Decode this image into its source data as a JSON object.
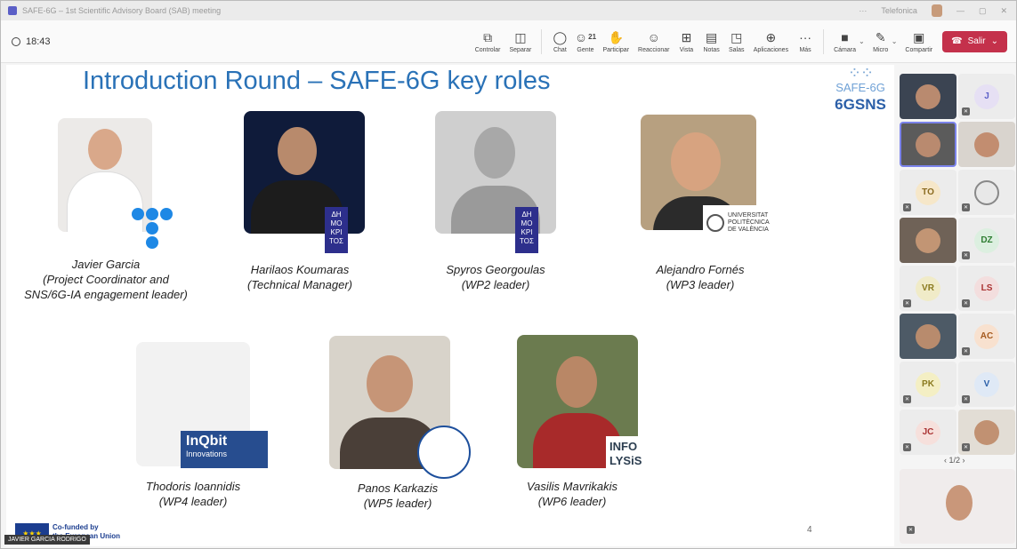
{
  "window": {
    "title": "SAFE-6G – 1st Scientific Advisory Board (SAB) meeting",
    "right_label": "Telefonica"
  },
  "toolbar": {
    "time": "18:43",
    "buttons": [
      {
        "label": "Controlar",
        "icon": "share-control-icon"
      },
      {
        "label": "Separar",
        "icon": "popout-icon"
      },
      {
        "label": "Chat",
        "icon": "chat-icon"
      },
      {
        "label": "Gente",
        "icon": "people-icon",
        "count": "21"
      },
      {
        "label": "Participar",
        "icon": "raise-hand-icon"
      },
      {
        "label": "Reaccionar",
        "icon": "smiley-icon"
      },
      {
        "label": "Vista",
        "icon": "grid-view-icon"
      },
      {
        "label": "Notas",
        "icon": "notes-icon"
      },
      {
        "label": "Salas",
        "icon": "rooms-icon"
      },
      {
        "label": "Aplicaciones",
        "icon": "apps-plus-icon"
      },
      {
        "label": "Más",
        "icon": "more-icon"
      }
    ],
    "media": [
      {
        "label": "Cámara",
        "icon": "camera-off-icon"
      },
      {
        "label": "Micro",
        "icon": "mic-off-icon"
      },
      {
        "label": "Compartir",
        "icon": "share-screen-icon"
      }
    ],
    "leave_label": "Salir",
    "accent_red": "#c4314b"
  },
  "slide": {
    "title": "Introduction Round – SAFE-6G key roles",
    "logo_safe": "SAFE-6G",
    "logo_sns": "6GSNS",
    "page_number": "4",
    "people": [
      {
        "name": "Javier Garcia",
        "role_line1": "(Project Coordinator and",
        "role_line2": "SNS/6G-IA engagement leader)"
      },
      {
        "name": "Harilaos Koumaras",
        "role_line1": "(Technical Manager)"
      },
      {
        "name": "Spyros Georgoulas",
        "role_line1": "(WP2 leader)"
      },
      {
        "name": "Alejandro Fornés",
        "role_line1": "(WP3 leader)"
      },
      {
        "name": "Thodoris Ioannidis",
        "role_line1": "(WP4 leader)"
      },
      {
        "name": "Panos Karkazis",
        "role_line1": "(WP5 leader)"
      },
      {
        "name": "Vasilis Mavrikakis",
        "role_line1": "(WP6 leader)"
      }
    ],
    "badges": {
      "upv_line1": "UNIVERSITAT",
      "upv_line2": "POLITÈCNICA",
      "upv_line3": "DE VALÈNCIA",
      "inqbit": "InQbit",
      "inqbit_sub": "Innovations",
      "infolysis_line1": "INFO",
      "infolysis_line2": "LYSiS",
      "demokritos": "ΔΗ ΜΟ ΚΡΙ ΤΟΣ"
    },
    "eu_line1": "Co-funded by",
    "eu_line2": "the European Union",
    "speaker": "JAVIER GARCIA RODRIGO"
  },
  "participants": {
    "tiles": [
      {
        "initials": "",
        "video": true
      },
      {
        "initials": "J",
        "video": false,
        "color": "#e6e0f4"
      },
      {
        "initials": "",
        "video": true,
        "active": true
      },
      {
        "initials": "",
        "video": true
      },
      {
        "initials": "TO",
        "video": false,
        "color": "#f6e7c9"
      },
      {
        "initials": "",
        "video": false,
        "color": "#e8e8e8",
        "generic": true
      },
      {
        "initials": "",
        "video": true
      },
      {
        "initials": "DZ",
        "video": false,
        "color": "#dcefe0"
      },
      {
        "initials": "VR",
        "video": false,
        "color": "#f0ebc8"
      },
      {
        "initials": "LS",
        "video": false,
        "color": "#f3dede"
      },
      {
        "initials": "",
        "video": true
      },
      {
        "initials": "AC",
        "video": false,
        "color": "#f8e1cf"
      },
      {
        "initials": "PK",
        "video": false,
        "color": "#f4efc4"
      },
      {
        "initials": "V",
        "video": false,
        "color": "#dfe9f6"
      },
      {
        "initials": "JC",
        "video": false,
        "color": "#f6e0dc"
      },
      {
        "initials": "",
        "video": true
      }
    ],
    "pager": "1/2"
  }
}
